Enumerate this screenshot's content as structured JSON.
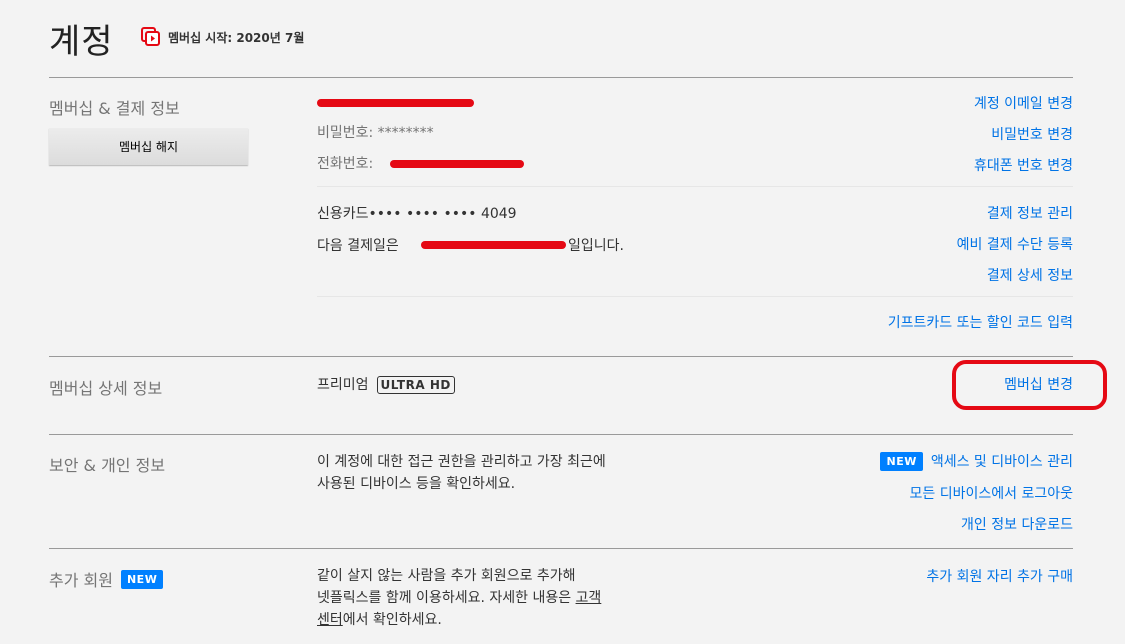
{
  "page": {
    "title": "계정",
    "member_since": "멤버십 시작: 2020년 7월"
  },
  "membership_billing": {
    "section_title": "멤버십 & 결제 정보",
    "cancel_button": "멤버십 해지",
    "password": "비밀번호: ********",
    "phone_label": "전화번호:",
    "card": "신용카드•••• •••• •••• 4049",
    "next_payment_prefix": "다음 결제일은",
    "next_payment_suffix": "일입니다.",
    "links": {
      "change_email": "계정 이메일 변경",
      "change_password": "비밀번호 변경",
      "change_phone": "휴대폰 번호 변경",
      "manage_payment": "결제 정보 관리",
      "backup_payment": "예비 결제 수단 등록",
      "billing_details": "결제 상세 정보",
      "gift_card": "기프트카드 또는 할인 코드 입력"
    }
  },
  "plan_details": {
    "section_title": "멤버십 상세 정보",
    "plan_name": "프리미엄",
    "plan_badge": "ULTRA HD",
    "change_plan": "멤버십 변경"
  },
  "security": {
    "section_title": "보안 & 개인 정보",
    "description_line1": "이 계정에 대한 접근 권한을 관리하고 가장 최근에",
    "description_line2": "사용된 디바이스 등을 확인하세요.",
    "new_badge": "NEW",
    "links": {
      "manage_access": "액세스 및 디바이스 관리",
      "sign_out_all": "모든 디바이스에서 로그아웃",
      "download_info": "개인 정보 다운로드"
    }
  },
  "extra_members": {
    "section_title": "추가 회원",
    "new_badge": "NEW",
    "description_line1": "같이 살지 않는 사람을 추가 회원으로 추가해",
    "description_line2_prefix": "넷플릭스를 함께 이용하세요. 자세한 내용은 ",
    "help_link_part1": "고객",
    "help_link_part2": "센터",
    "description_line3_suffix": "에서 확인하세요.",
    "buy_slot": "추가 회원 자리 추가 구매"
  },
  "colors": {
    "link": "#0073e6",
    "accent_red": "#e50914",
    "badge_blue": "#0080ff"
  }
}
